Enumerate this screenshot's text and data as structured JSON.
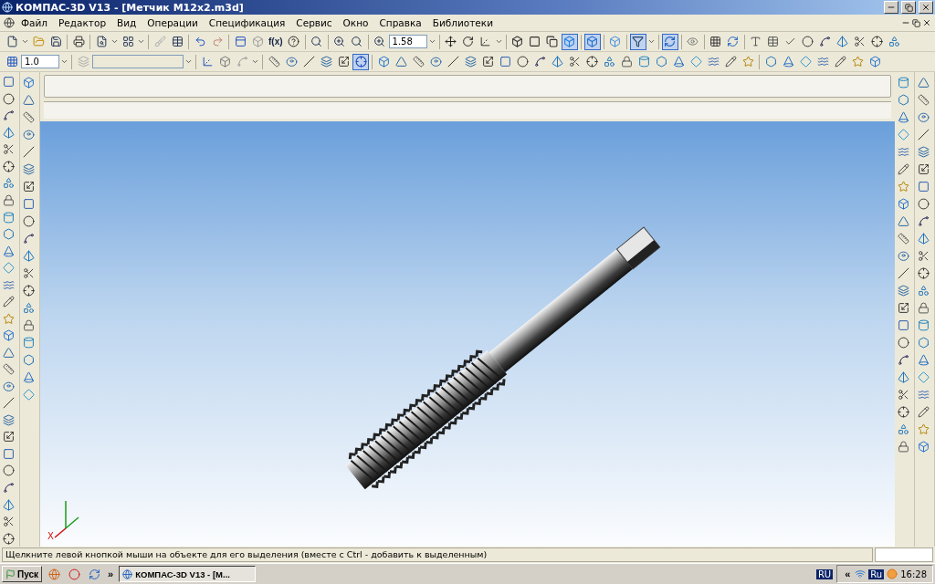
{
  "window": {
    "title": "КОМПАС-3D V13 - [Метчик M12x2.m3d]"
  },
  "menu": [
    "Файл",
    "Редактор",
    "Вид",
    "Операции",
    "Спецификация",
    "Сервис",
    "Окно",
    "Справка",
    "Библиотеки"
  ],
  "toolbar": {
    "fx_button": "f(x)",
    "scale_field": "1.58",
    "step_field": "1.0"
  },
  "view_modes": [
    {
      "selected": false
    },
    {
      "selected": false
    },
    {
      "selected": false
    },
    {
      "selected": true
    }
  ],
  "toggles": [
    {
      "on": true
    },
    {
      "on": true
    },
    {
      "on": true
    },
    {
      "on": true
    }
  ],
  "viewport": {
    "axis_label": "X"
  },
  "status_bar": {
    "message": "Щелкните левой кнопкой мыши на объекте для его выделения (вместе с Ctrl - добавить к выделенным)"
  },
  "taskbar": {
    "start": "Пуск",
    "more": "»",
    "task": "КОМПАС-3D V13 - [М...",
    "language": "RU",
    "tray_expand": "«",
    "tray_language": "Ru",
    "clock": "16:28"
  }
}
